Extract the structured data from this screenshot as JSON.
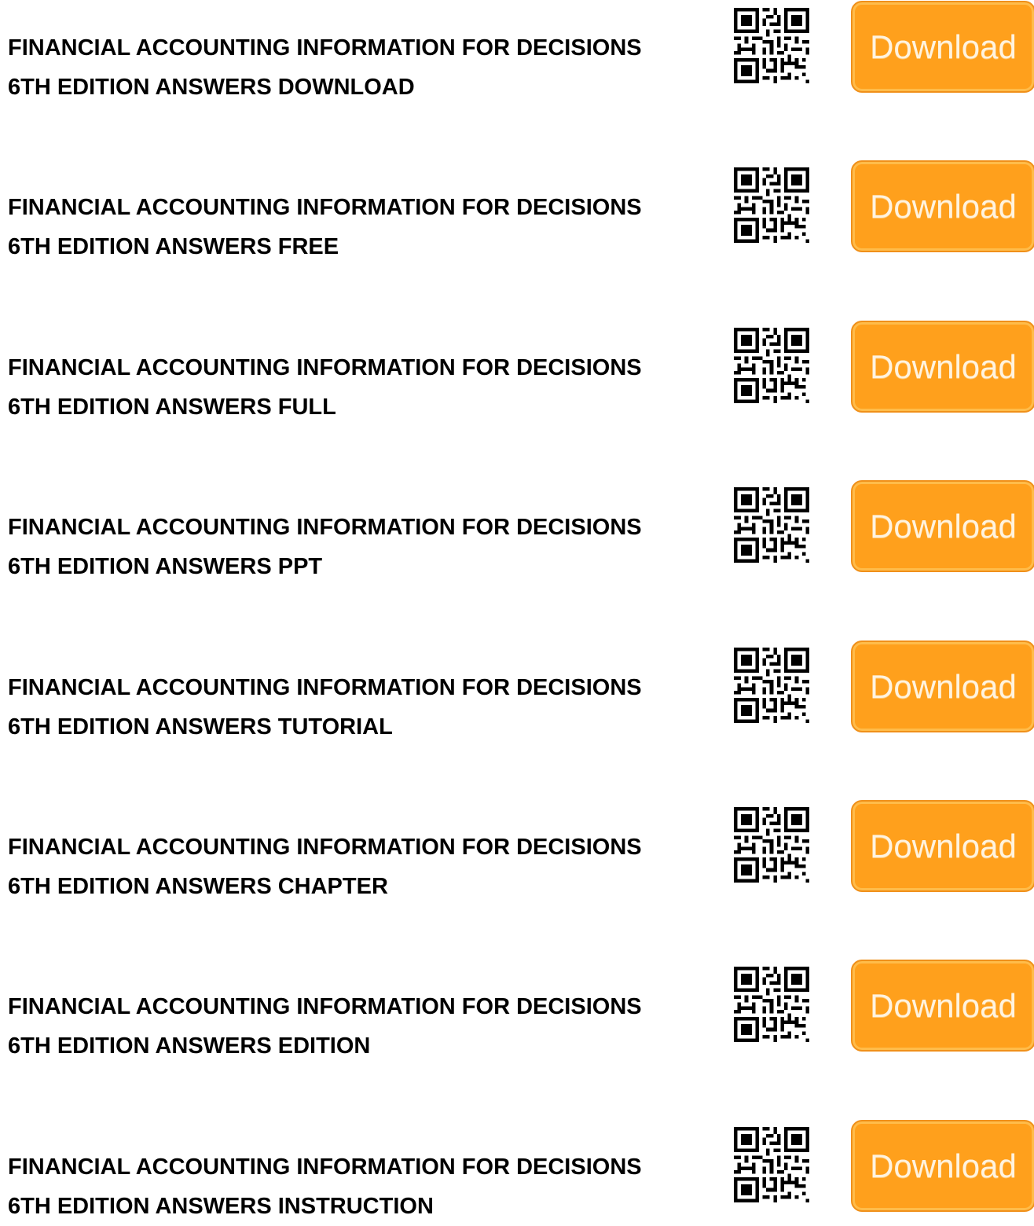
{
  "entries": [
    {
      "line1": "FINANCIAL ACCOUNTING INFORMATION FOR DECISIONS",
      "line2": "6TH EDITION ANSWERS DOWNLOAD",
      "button_label": "Download"
    },
    {
      "line1": "FINANCIAL ACCOUNTING INFORMATION FOR DECISIONS",
      "line2": "6TH EDITION ANSWERS FREE",
      "button_label": "Download"
    },
    {
      "line1": "FINANCIAL ACCOUNTING INFORMATION FOR DECISIONS",
      "line2": "6TH EDITION ANSWERS FULL",
      "button_label": "Download"
    },
    {
      "line1": "FINANCIAL ACCOUNTING INFORMATION FOR DECISIONS",
      "line2": "6TH EDITION ANSWERS PPT",
      "button_label": "Download"
    },
    {
      "line1": "FINANCIAL ACCOUNTING INFORMATION FOR DECISIONS",
      "line2": "6TH EDITION ANSWERS TUTORIAL",
      "button_label": "Download"
    },
    {
      "line1": "FINANCIAL ACCOUNTING INFORMATION FOR DECISIONS",
      "line2": "6TH EDITION ANSWERS CHAPTER",
      "button_label": "Download"
    },
    {
      "line1": "FINANCIAL ACCOUNTING INFORMATION FOR DECISIONS",
      "line2": "6TH EDITION ANSWERS EDITION",
      "button_label": "Download"
    },
    {
      "line1": "FINANCIAL ACCOUNTING INFORMATION FOR DECISIONS",
      "line2": "6TH EDITION ANSWERS INSTRUCTION",
      "button_label": "Download"
    }
  ],
  "icons": {
    "qr": "qr-code-icon"
  },
  "colors": {
    "button": "#ffa01c",
    "button_text": "#fff3df",
    "title_text": "#000000"
  }
}
